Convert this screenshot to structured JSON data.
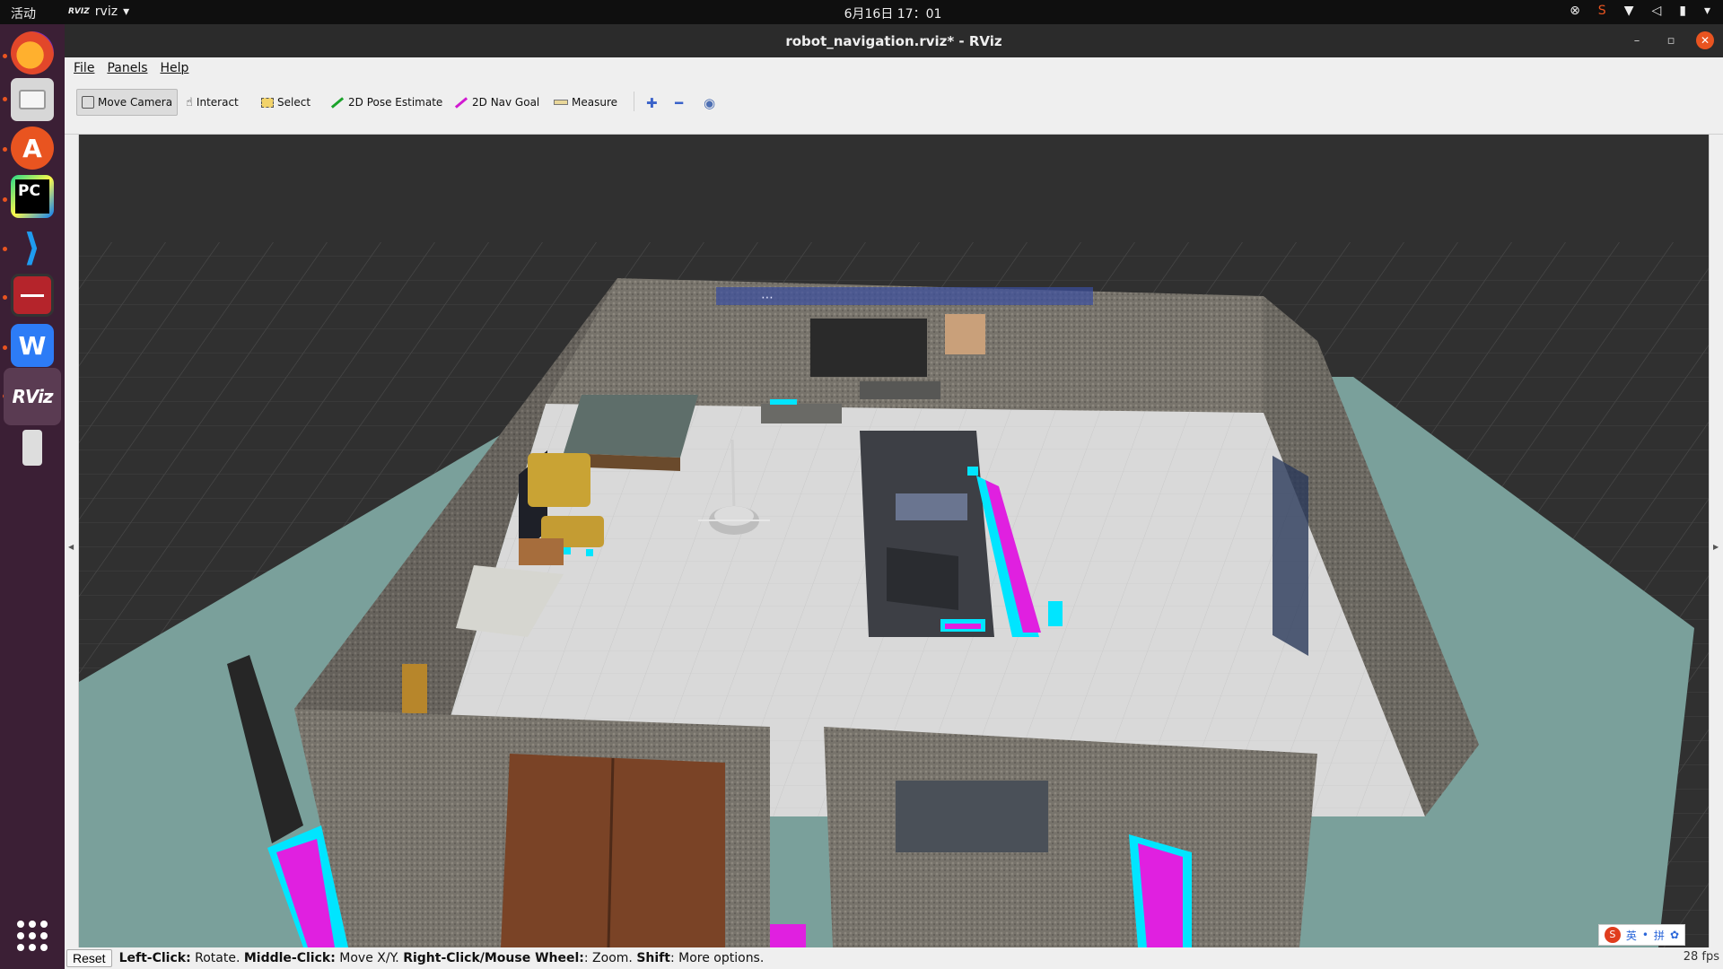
{
  "topbar": {
    "activities": "活动",
    "app_name": "rviz",
    "app_logo_text": "RVIZ",
    "clock": "6月16日  17：01"
  },
  "dock": {
    "items": [
      "firefox",
      "files",
      "app-center",
      "pycharm",
      "vscode",
      "screen-recorder",
      "wps",
      "rviz",
      "usb-drive"
    ],
    "pycharm_text": "PC",
    "rviz_text": "RViz"
  },
  "window": {
    "title": "robot_navigation.rviz* - RViz",
    "minimize": "–",
    "maximize": "▫",
    "close": "✕"
  },
  "menubar": {
    "file": "File",
    "panels": "Panels",
    "help": "Help"
  },
  "toolbar": {
    "move_camera": "Move Camera",
    "interact": "Interact",
    "select": "Select",
    "pose_estimate": "2D Pose Estimate",
    "nav_goal": "2D Nav Goal",
    "measure": "Measure",
    "add_tool": "✚",
    "remove_tool": "━",
    "view_tool": "◉"
  },
  "viewport": {
    "wall_banner": "⋯"
  },
  "ime": {
    "logo": "S",
    "lang": "英",
    "punct": "•",
    "mode": "拼",
    "settings": "✿"
  },
  "statusbar": {
    "reset": "Reset",
    "hint_left_key": "Left-Click:",
    "hint_left_val": " Rotate. ",
    "hint_mid_key": "Middle-Click:",
    "hint_mid_val": " Move X/Y. ",
    "hint_right_key": "Right-Click/Mouse Wheel:",
    "hint_right_val": ": Zoom. ",
    "hint_shift_key": "Shift",
    "hint_shift_val": ": More options.",
    "fps": "28 fps"
  },
  "colors": {
    "accent": "#e95420",
    "dock_bg": "#3b1f35",
    "viewport_bg": "#303030",
    "map_free": "#d9d9d9",
    "map_unknown": "#7aa09b",
    "costmap_cyan": "#00e5ff",
    "costmap_magenta": "#e020e0"
  }
}
